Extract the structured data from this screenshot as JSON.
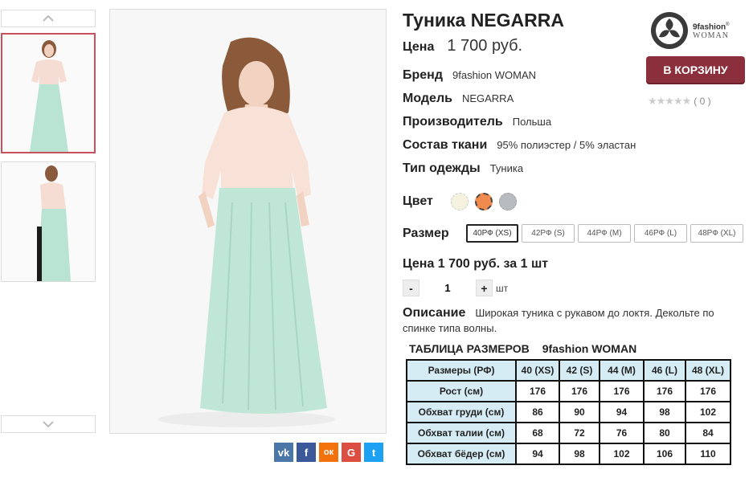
{
  "product": {
    "title": "Туника NEGARRA",
    "price_label": "Цена",
    "price_value": "1 700 руб."
  },
  "attributes": [
    {
      "label": "Бренд",
      "value": "9fashion WOMAN"
    },
    {
      "label": "Модель",
      "value": "NEGARRA"
    },
    {
      "label": "Производитель",
      "value": "Польша"
    },
    {
      "label": "Состав ткани",
      "value": "95% полиэстер / 5% эластан"
    },
    {
      "label": "Тип одежды",
      "value": "Туника"
    }
  ],
  "brand_logo": {
    "line1": "9fashion",
    "registered": "®",
    "line2": "WOMAN"
  },
  "cart_button_label": "В КОРЗИНУ",
  "rating": {
    "stars": "★★★★★",
    "count": "( 0 )",
    "value": 0,
    "max": 5
  },
  "color": {
    "label": "Цвет",
    "swatches": [
      "#f5f2df",
      "#f08a4e",
      "#b8bcc0"
    ],
    "selected_index": 1
  },
  "size": {
    "label": "Размер",
    "options": [
      "40РФ (XS)",
      "42РФ (S)",
      "44РФ (M)",
      "46РФ (L)",
      "48РФ (XL)"
    ],
    "selected_index": 0
  },
  "unit_price": "Цена 1 700 руб. за 1 шт",
  "quantity": {
    "minus": "-",
    "value": "1",
    "plus": "+",
    "unit": "шт"
  },
  "description": {
    "label": "Описание",
    "text": "Широкая туника с рукавом до локтя. Декольте по спинке типа волны."
  },
  "size_table": {
    "title": "ТАБЛИЦА РАЗМЕРОВ",
    "brand": "9fashion WOMAN",
    "headers": [
      "Размеры (РФ)",
      "40 (XS)",
      "42 (S)",
      "44 (M)",
      "46 (L)",
      "48 (XL)"
    ],
    "rows": [
      [
        "Рост (см)",
        "176",
        "176",
        "176",
        "176",
        "176"
      ],
      [
        "Обхват груди (см)",
        "86",
        "90",
        "94",
        "98",
        "102"
      ],
      [
        "Обхват талии (см)",
        "68",
        "72",
        "76",
        "80",
        "84"
      ],
      [
        "Обхват бёдер (см)",
        "94",
        "98",
        "102",
        "106",
        "110"
      ]
    ]
  },
  "social": [
    {
      "icon": "vk-icon",
      "glyph": "vk",
      "color": "#4a76a8"
    },
    {
      "icon": "facebook-icon",
      "glyph": "f",
      "color": "#3b5998"
    },
    {
      "icon": "odnoklassniki-icon",
      "glyph": "ок",
      "color": "#f2720c"
    },
    {
      "icon": "google-plus-icon",
      "glyph": "G",
      "color": "#dc4e41"
    },
    {
      "icon": "twitter-icon",
      "glyph": "t",
      "color": "#1da1f2"
    }
  ],
  "colors": {
    "accent": "#8b2f3c",
    "thumb_selected_border": "#c9505f",
    "table_header_bg": "#d6ecf5"
  }
}
